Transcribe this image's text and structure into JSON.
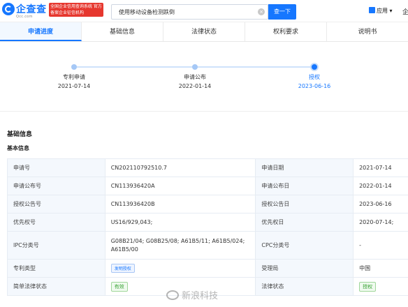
{
  "header": {
    "logo_text": "企查查",
    "logo_sub": "Qcc.com",
    "credit_badge": "全国企业信用查询系统 官方备案企业征信机构",
    "search_value": "使用移动设备检测跌倒",
    "search_button": "查一下",
    "apps_label": "应用",
    "corner_text": "企"
  },
  "tabs": [
    {
      "label": "申请进度"
    },
    {
      "label": "基础信息"
    },
    {
      "label": "法律状态"
    },
    {
      "label": "权利要求"
    },
    {
      "label": "说明书"
    }
  ],
  "timeline": [
    {
      "label": "专利申请",
      "date": "2021-07-14"
    },
    {
      "label": "申请公布",
      "date": "2022-01-14"
    },
    {
      "label": "授权",
      "date": "2023-06-16"
    }
  ],
  "section_title": "基础信息",
  "sub_title": "基本信息",
  "table": {
    "r1": {
      "k1": "申请号",
      "v1": "CN202110792510.7",
      "k2": "申请日期",
      "v2": "2021-07-14"
    },
    "r2": {
      "k1": "申请公布号",
      "v1": "CN113936420A",
      "k2": "申请公布日",
      "v2": "2022-01-14"
    },
    "r3": {
      "k1": "授权公告号",
      "v1": "CN113936420B",
      "k2": "授权公告日",
      "v2": "2023-06-16"
    },
    "r4": {
      "k1": "优先权号",
      "v1": "US16/929,043;",
      "k2": "优先权日",
      "v2": "2020-07-14;"
    },
    "r5": {
      "k1": "IPC分类号",
      "v1": "G08B21/04; G08B25/08; A61B5/11; A61B5/024; A61B5/00",
      "k2": "CPC分类号",
      "v2": "-"
    },
    "r6": {
      "k1": "专利类型",
      "v1": "发明授权",
      "k2": "受理局",
      "v2": "中国"
    },
    "r7": {
      "k1": "简单法律状态",
      "v1": "有效",
      "k2": "法律状态",
      "v2": "授权"
    }
  },
  "watermark": "新浪科技",
  "colors": {
    "accent": "#1677ff",
    "valid_green": "#3aa236",
    "badge_red": "#e6372e"
  }
}
